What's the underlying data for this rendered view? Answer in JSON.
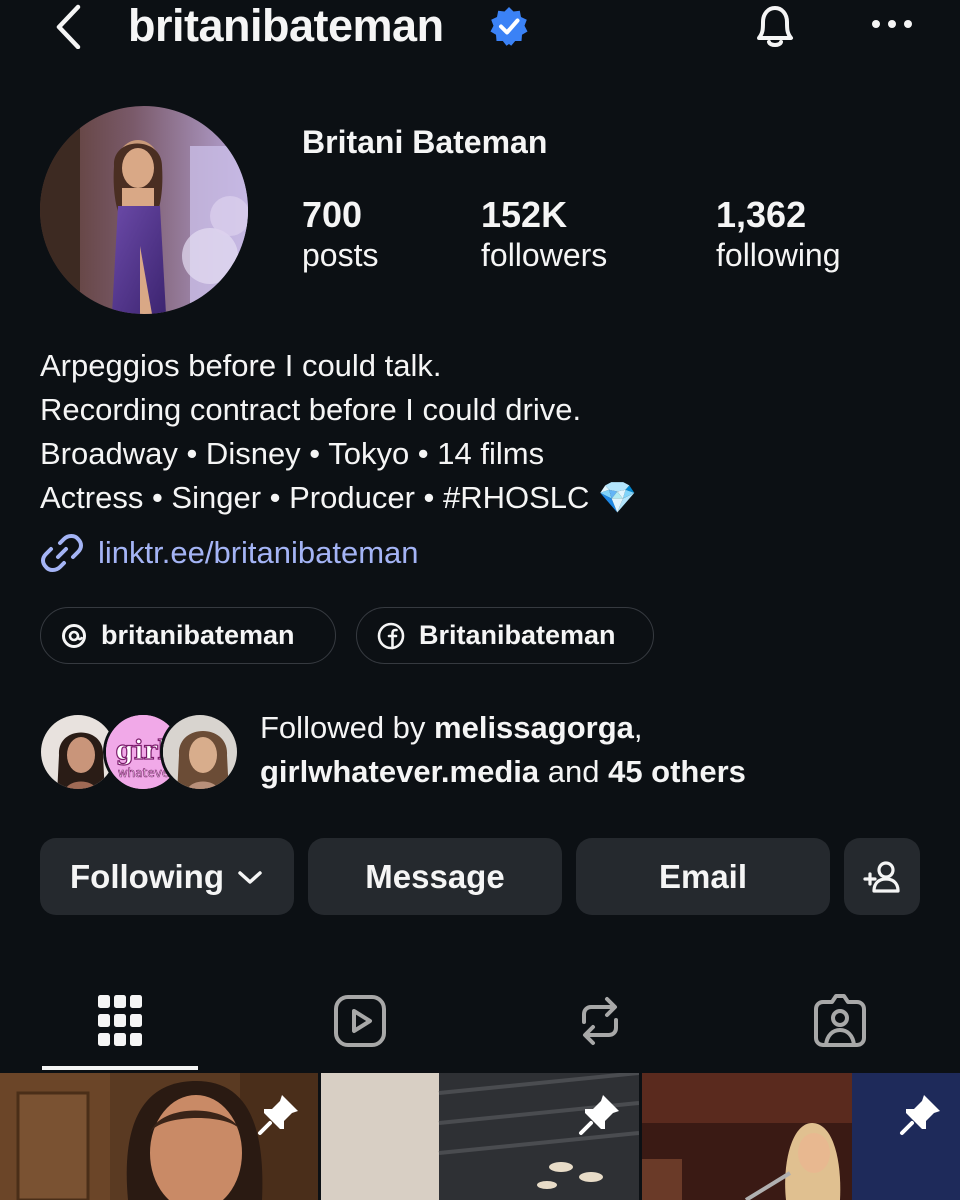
{
  "header": {
    "username": "britanibateman",
    "back_icon": "chevron-left-icon",
    "verified_icon": "verified-badge-icon",
    "bell_icon": "bell-icon",
    "more_icon": "ellipsis-icon"
  },
  "profile": {
    "full_name": "Britani Bateman",
    "stats": [
      {
        "value": "700",
        "label": "posts"
      },
      {
        "value": "152K",
        "label": "followers"
      },
      {
        "value": "1,362",
        "label": "following"
      }
    ],
    "bio": [
      "Arpeggios before I could talk.",
      "Recording contract before I could drive.",
      "Broadway • Disney • Tokyo • 14 films",
      "Actress • Singer • Producer • #RHOSLC 💎"
    ],
    "link": "linktr.ee/britanibateman"
  },
  "social_pills": [
    {
      "label": "britanibateman",
      "icon": "threads-icon"
    },
    {
      "label": "Britanibateman",
      "icon": "facebook-icon"
    }
  ],
  "followed_by": {
    "prefix": "Followed by ",
    "user1": "melissagorga",
    "sep": ",",
    "user2": "girlwhatever.media",
    "mid": " and ",
    "others": "45 others",
    "avatar2_text_1": "girl,",
    "avatar2_text_2": "whatever"
  },
  "actions": {
    "following": "Following",
    "message": "Message",
    "email": "Email",
    "add_user_icon": "add-person-icon"
  },
  "tabs": [
    {
      "icon": "grid-icon",
      "active": true
    },
    {
      "icon": "reels-icon",
      "active": false
    },
    {
      "icon": "reposts-icon",
      "active": false
    },
    {
      "icon": "tagged-icon",
      "active": false
    }
  ],
  "colors": {
    "background": "#0c1014",
    "button": "#25292e",
    "link": "#a4b4f5",
    "verified": "#3b82f6"
  }
}
